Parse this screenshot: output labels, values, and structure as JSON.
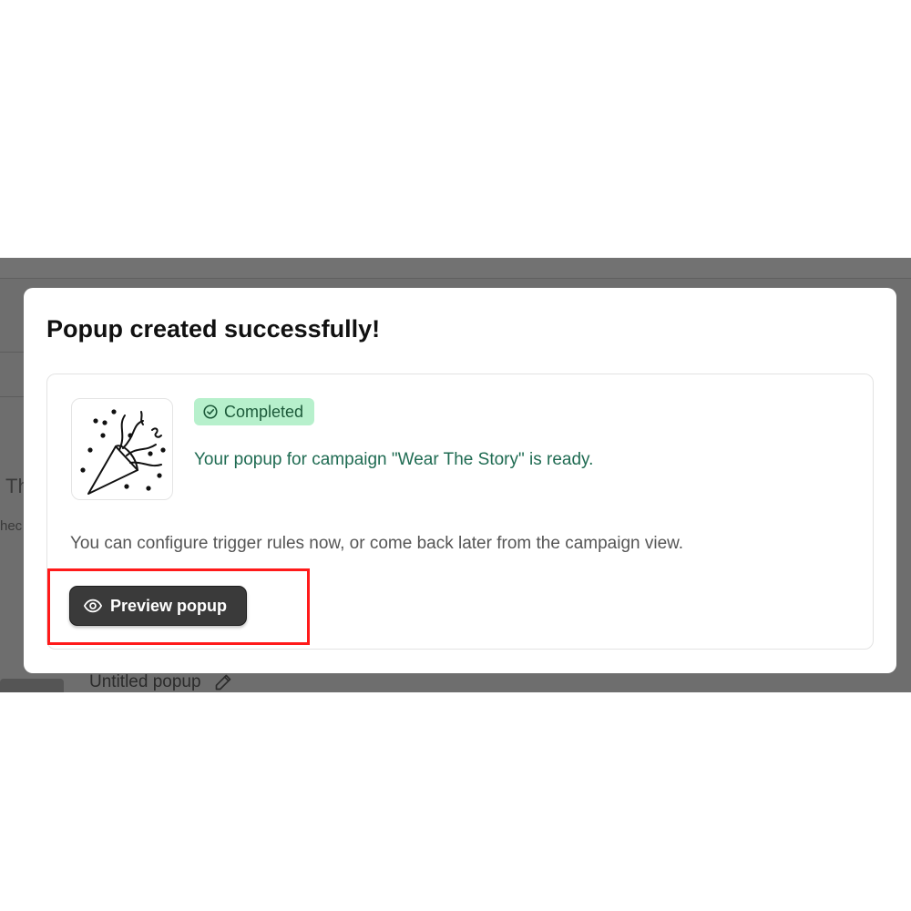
{
  "background": {
    "left_text_1": "Th",
    "left_text_2": "hec",
    "untitled_label": "Untitled popup",
    "edit_icon": "pencil-icon"
  },
  "modal": {
    "title": "Popup created successfully!",
    "illustration_icon": "party-popper-icon",
    "status": {
      "label": "Completed",
      "icon": "check-circle-icon",
      "bg_color": "#b7f0cc",
      "text_color": "#1d5a3a"
    },
    "ready_message": "Your popup for campaign \"Wear The Story\" is ready.",
    "config_message": "You can configure trigger rules now, or come back later from the campaign view.",
    "preview_button": {
      "label": "Preview popup",
      "icon": "eye-icon"
    },
    "highlight_color": "#ff1a1a"
  }
}
